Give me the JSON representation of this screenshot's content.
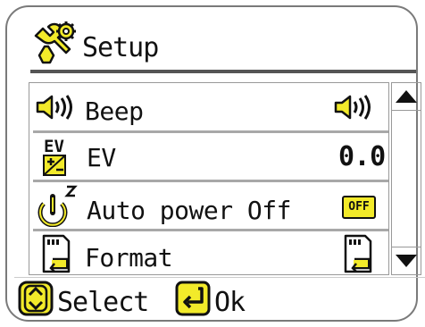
{
  "header": {
    "title": "Setup",
    "icon": "wrench-gear-icon"
  },
  "menu": {
    "items": [
      {
        "label": "Beep",
        "icon": "speaker-icon",
        "value_icon": "speaker-icon"
      },
      {
        "label": "EV",
        "icon": "ev-icon",
        "value": "0.0"
      },
      {
        "label": "Auto power Off",
        "icon": "power-sleep-icon",
        "value_badge": "OFF"
      },
      {
        "label": "Format",
        "icon": "sd-card-format-icon",
        "value_icon": "sd-card-format-icon"
      }
    ]
  },
  "footer": {
    "select_label": "Select",
    "ok_label": "Ok"
  },
  "colors": {
    "accent": "#f2ea2a",
    "outline": "#111111",
    "border": "#7a7a7a"
  }
}
